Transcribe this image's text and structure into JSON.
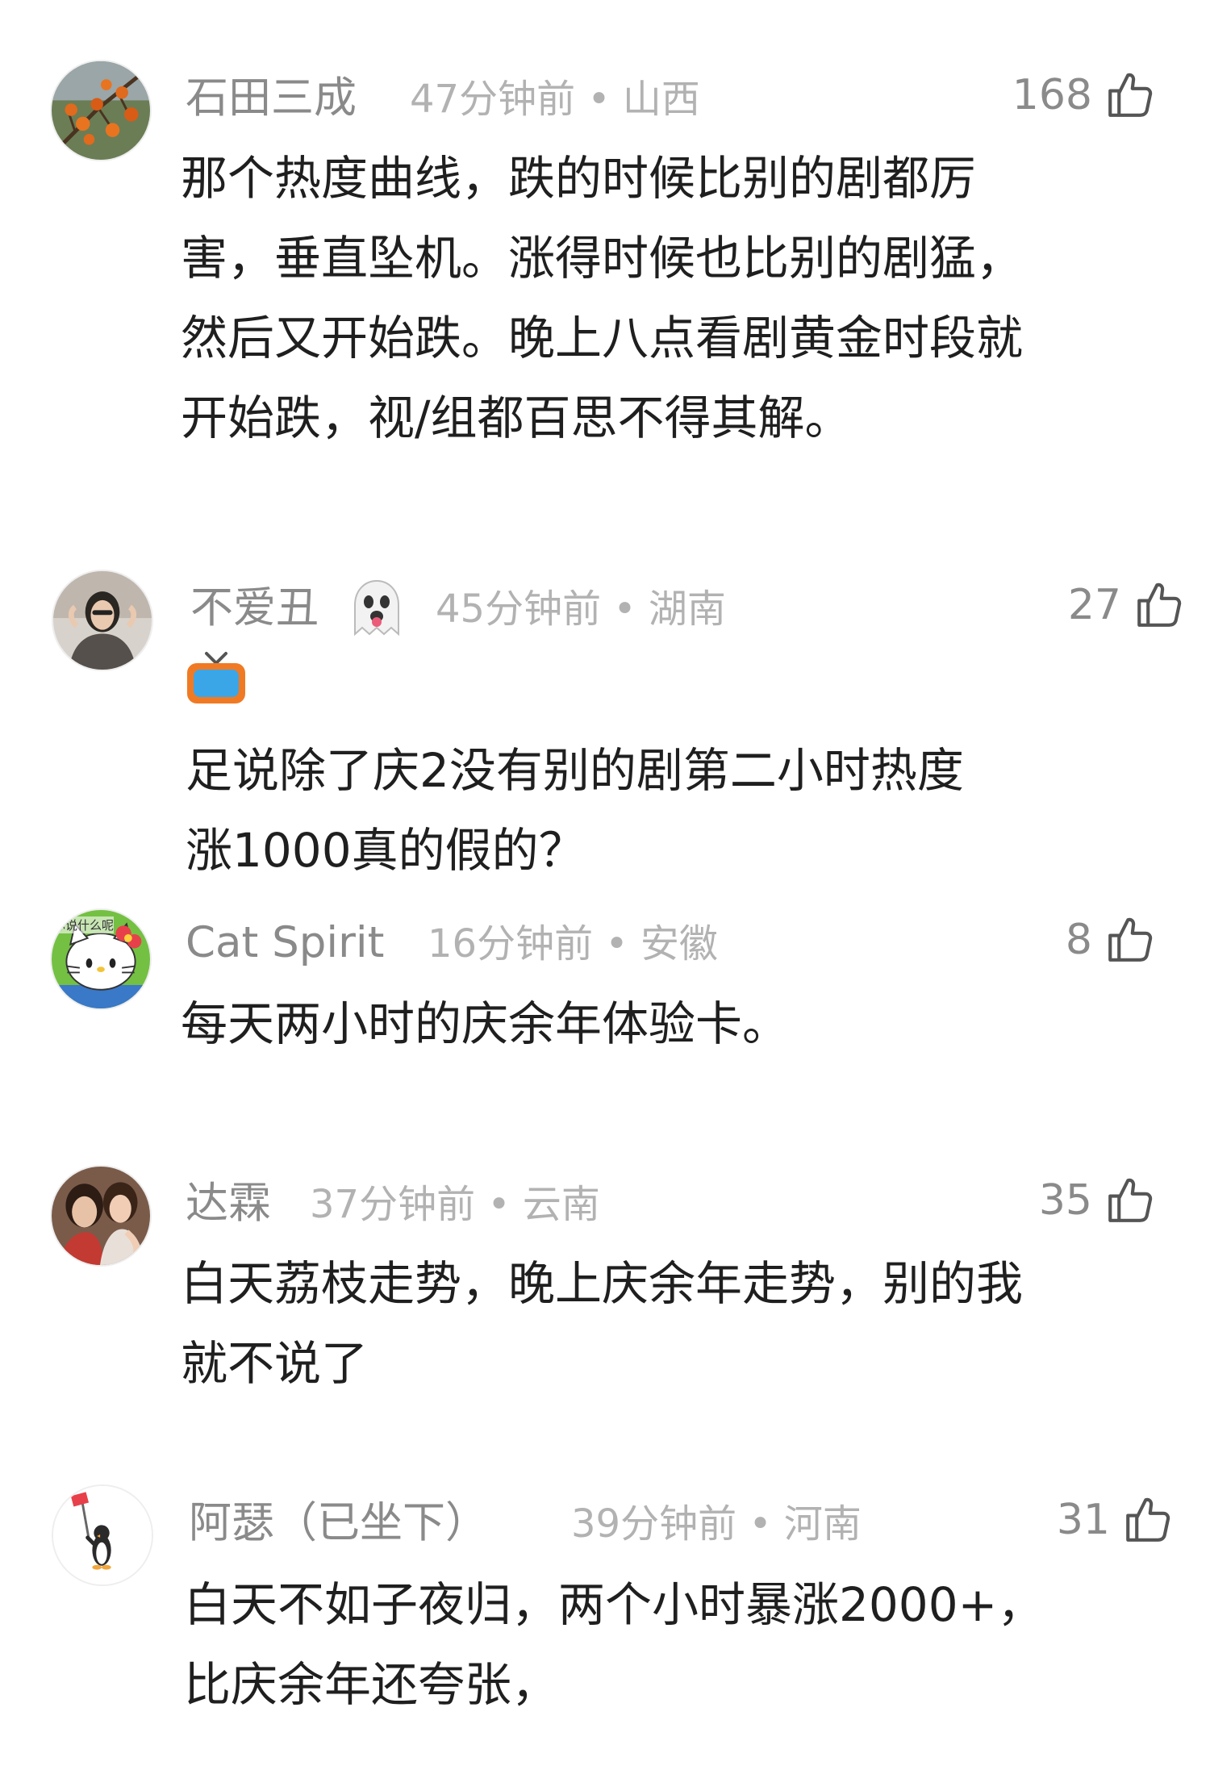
{
  "comments": [
    {
      "username": "石田三成",
      "meta": "47分钟前 • 山西",
      "likes": "168",
      "avatar_icon": "persimmon-branch-avatar",
      "lines": [
        "那个热度曲线，跌的时候比别的剧都厉",
        "害，垂直坠机。涨得时候也比别的剧猛，",
        "然后又开始跌。晚上八点看剧黄金时段就",
        "开始跌，视/组都百思不得其解。"
      ]
    },
    {
      "username": "不爱丑",
      "meta": "45分钟前 • 湖南",
      "likes": "27",
      "avatar_icon": "woman-photo-avatar",
      "name_emoji": "ghost-tongue-emoji",
      "content_emoji": "tv-emoji",
      "lines": [
        "足说除了庆2没有别的剧第二小时热度",
        "涨1000真的假的？"
      ]
    },
    {
      "username": "Cat Spirit",
      "meta": "16分钟前 • 安徽",
      "likes": "8",
      "avatar_icon": "hello-kitty-avatar",
      "avatar_text": "你说什么呢",
      "lines": [
        "每天两小时的庆余年体验卡。"
      ]
    },
    {
      "username": "达霖",
      "meta": "37分钟前 • 云南",
      "likes": "35",
      "avatar_icon": "two-women-photo-avatar",
      "lines": [
        "白天荔枝走势，晚上庆余年走势，别的我",
        "就不说了"
      ]
    },
    {
      "username": "阿瑟（已坐下）",
      "meta": "39分钟前 • 河南",
      "likes": "31",
      "avatar_icon": "penguin-flag-avatar",
      "lines": [
        "白天不如子夜归，两个小时暴涨2000+，",
        "比庆余年还夸张，"
      ]
    }
  ]
}
